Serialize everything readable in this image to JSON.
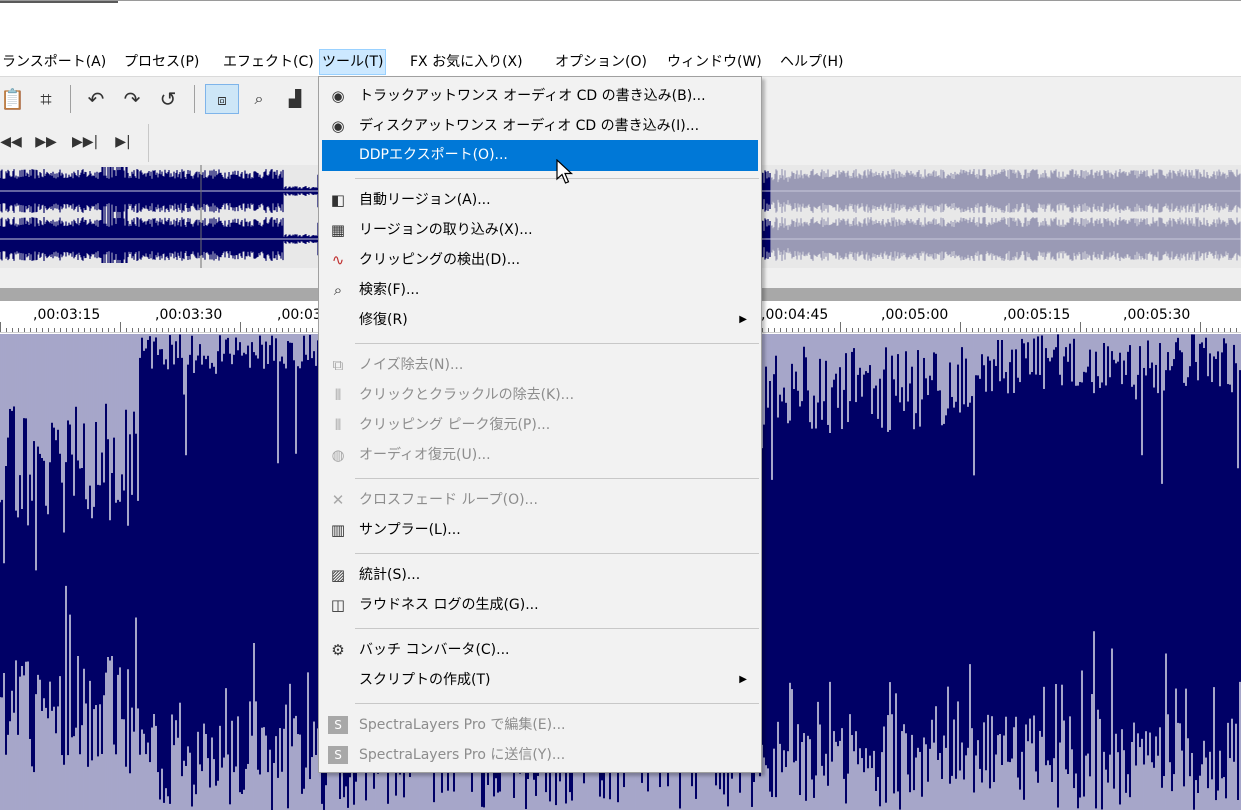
{
  "menubar": {
    "items": [
      "ランスポート(A)",
      "プロセス(P)",
      "エフェクト(C)",
      "ツール(T)",
      "FX お気に入り(X)",
      "オプション(O)",
      "ウィンドウ(W)",
      "ヘルプ(H)"
    ]
  },
  "toolbar": {
    "icons": [
      "paste-icon",
      "crop-icon",
      "undo-icon",
      "redo-icon",
      "repeat-icon",
      "trim-icon",
      "zoom-icon",
      "level-icon"
    ],
    "transport": [
      "rewind-icon",
      "fast-forward-icon",
      "go-to-end-icon",
      "next-marker-icon"
    ]
  },
  "ruler": {
    "labels": [
      ",00:03:15",
      ",00:03:30",
      ",00:03",
      ",00:04:45",
      ",00:05:00",
      ",00:05:15",
      ",00:05:30"
    ]
  },
  "tools_menu": {
    "items": [
      {
        "label": "トラックアットワンス オーディオ CD の書き込み(B)...",
        "icon": "cd-burn-icon",
        "enabled": true
      },
      {
        "label": "ディスクアットワンス オーディオ CD の書き込み(I)...",
        "icon": "cd-burn-disc-icon",
        "enabled": true
      },
      {
        "label": "DDPエクスポート(O)...",
        "icon": "",
        "enabled": true,
        "highlighted": true
      },
      {
        "label": "自動リージョン(A)...",
        "icon": "auto-region-icon",
        "enabled": true
      },
      {
        "label": "リージョンの取り込み(X)...",
        "icon": "region-import-icon",
        "enabled": true
      },
      {
        "label": "クリッピングの検出(D)...",
        "icon": "clip-detect-icon",
        "enabled": true
      },
      {
        "label": "検索(F)...",
        "icon": "search-icon",
        "enabled": true
      },
      {
        "label": "修復(R)",
        "icon": "",
        "enabled": true,
        "submenu": true
      },
      {
        "label": "ノイズ除去(N)...",
        "icon": "noise-reduction-icon",
        "enabled": false
      },
      {
        "label": "クリックとクラックルの除去(K)...",
        "icon": "click-removal-icon",
        "enabled": false
      },
      {
        "label": "クリッピング ピーク復元(P)...",
        "icon": "clip-restore-icon",
        "enabled": false
      },
      {
        "label": "オーディオ復元(U)...",
        "icon": "audio-restore-icon",
        "enabled": false
      },
      {
        "label": "クロスフェード ループ(O)...",
        "icon": "crossfade-icon",
        "enabled": false
      },
      {
        "label": "サンプラー(L)...",
        "icon": "sampler-icon",
        "enabled": true
      },
      {
        "label": "統計(S)...",
        "icon": "statistics-icon",
        "enabled": true
      },
      {
        "label": "ラウドネス ログの生成(G)...",
        "icon": "loudness-icon",
        "enabled": true
      },
      {
        "label": "バッチ コンバータ(C)...",
        "icon": "batch-icon",
        "enabled": true
      },
      {
        "label": "スクリプトの作成(T)",
        "icon": "",
        "enabled": true,
        "submenu": true
      },
      {
        "label": "SpectraLayers Pro で編集(E)...",
        "icon": "spectralayers-icon",
        "enabled": false
      },
      {
        "label": "SpectraLayers Pro に送信(Y)...",
        "icon": "spectralayers-send-icon",
        "enabled": false
      }
    ]
  },
  "colors": {
    "waveform": "#000066",
    "highlight": "#0078d7",
    "menu_bg": "#f2f2f2",
    "overview_wave": "#000066",
    "overview_wave_dim": "#9a9ab5"
  }
}
